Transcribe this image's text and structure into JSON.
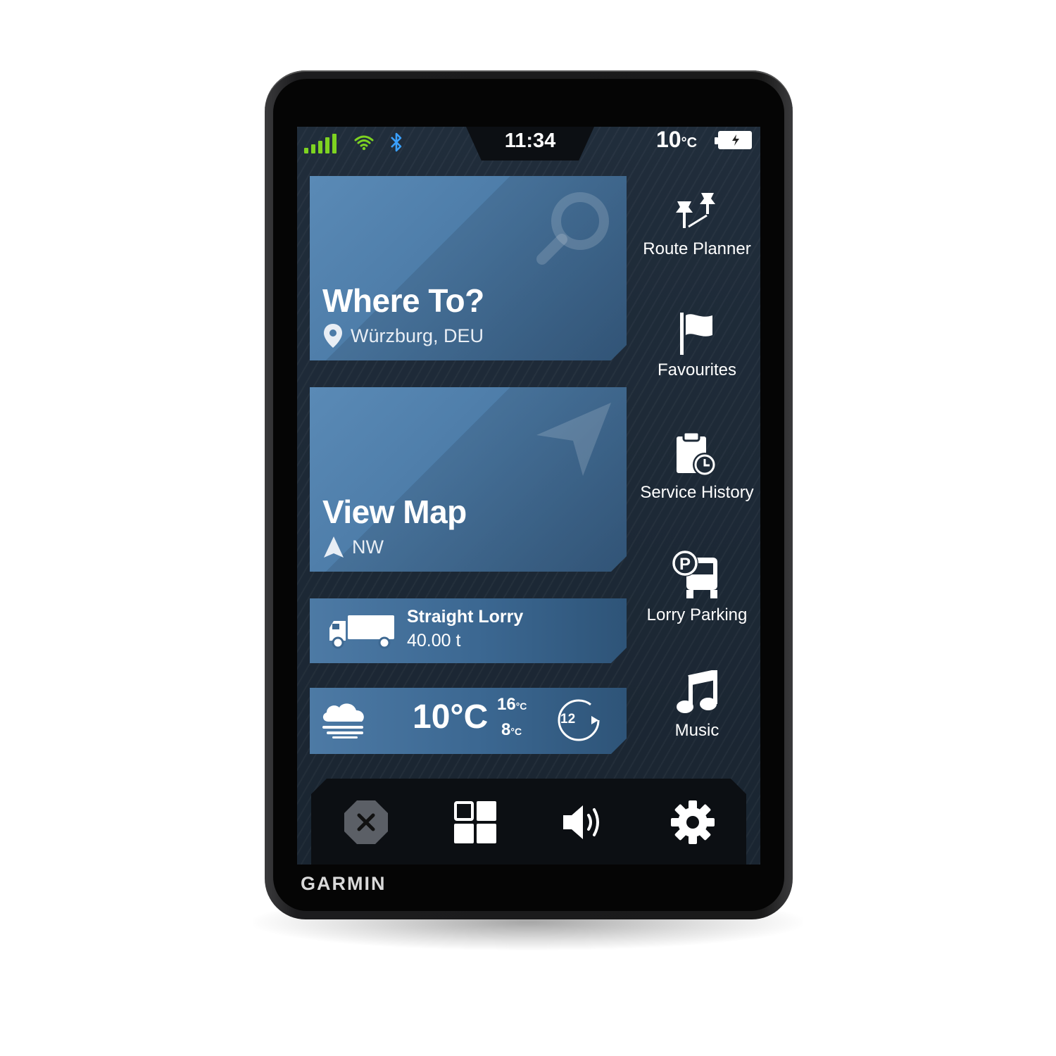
{
  "status_bar": {
    "time": "11:34",
    "temperature": "10",
    "temperature_unit": "°C",
    "signal_icon": "cellular-signal-icon",
    "wifi_icon": "wifi-icon",
    "bluetooth_icon": "bluetooth-icon",
    "battery_icon": "battery-charging-icon"
  },
  "cards": {
    "where_to": {
      "title": "Where To?",
      "location": "Würzburg, DEU",
      "icon": "search-icon"
    },
    "view_map": {
      "title": "View Map",
      "heading": "NW",
      "icon": "navigation-arrow-icon"
    },
    "vehicle": {
      "name": "Straight Lorry",
      "weight": "40.00 t",
      "icon": "truck-icon"
    },
    "weather": {
      "current": "10°C",
      "high": "16",
      "low": "8",
      "forecast_hours": "12",
      "icon": "cloud-fog-icon"
    }
  },
  "side_menu": [
    {
      "label": "Route Planner",
      "icon": "pins-route-icon"
    },
    {
      "label": "Favourites",
      "icon": "flag-icon"
    },
    {
      "label": "Service History",
      "icon": "clipboard-clock-icon"
    },
    {
      "label": "Lorry Parking",
      "icon": "truck-parking-icon"
    },
    {
      "label": "Music",
      "icon": "music-note-icon"
    }
  ],
  "bottom_bar": {
    "buttons": [
      "close-icon",
      "apps-grid-icon",
      "volume-icon",
      "gear-icon"
    ]
  },
  "brand": "GARMIN",
  "colors": {
    "accent_green": "#7ed321",
    "bluetooth": "#3aa0ff",
    "card_blue": "#4c7ba7"
  }
}
